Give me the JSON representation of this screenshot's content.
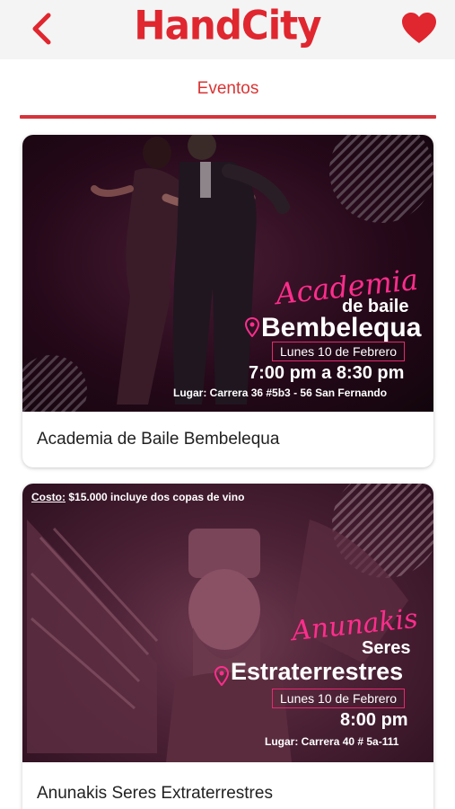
{
  "app": {
    "name": "HandCity"
  },
  "header": {
    "back_icon": "chevron-left-icon",
    "favorite_icon": "heart-icon"
  },
  "tab": {
    "label": "Eventos"
  },
  "colors": {
    "accent": "#e0262f",
    "script_pink": "#ff2d8c"
  },
  "events": [
    {
      "title": "Academia de Baile Bembelequa",
      "poster": {
        "script": "Academia",
        "line1": "de baile",
        "line2": "Bembelequa",
        "date": "Lunes 10 de Febrero",
        "time": "7:00 pm a 8:30 pm",
        "place": "Lugar: Carrera 36 #5b3 - 56 San Fernando"
      }
    },
    {
      "title": "Anunakis Seres Extraterrestres",
      "poster": {
        "cost_label": "Costo:",
        "cost_text": "$15.000 incluye dos copas de vino",
        "script": "Anunakis",
        "line1": "Seres",
        "line2": "Estraterrestres",
        "date": "Lunes 10 de Febrero",
        "time": "8:00 pm",
        "place": "Lugar: Carrera 40 # 5a-111"
      }
    }
  ]
}
